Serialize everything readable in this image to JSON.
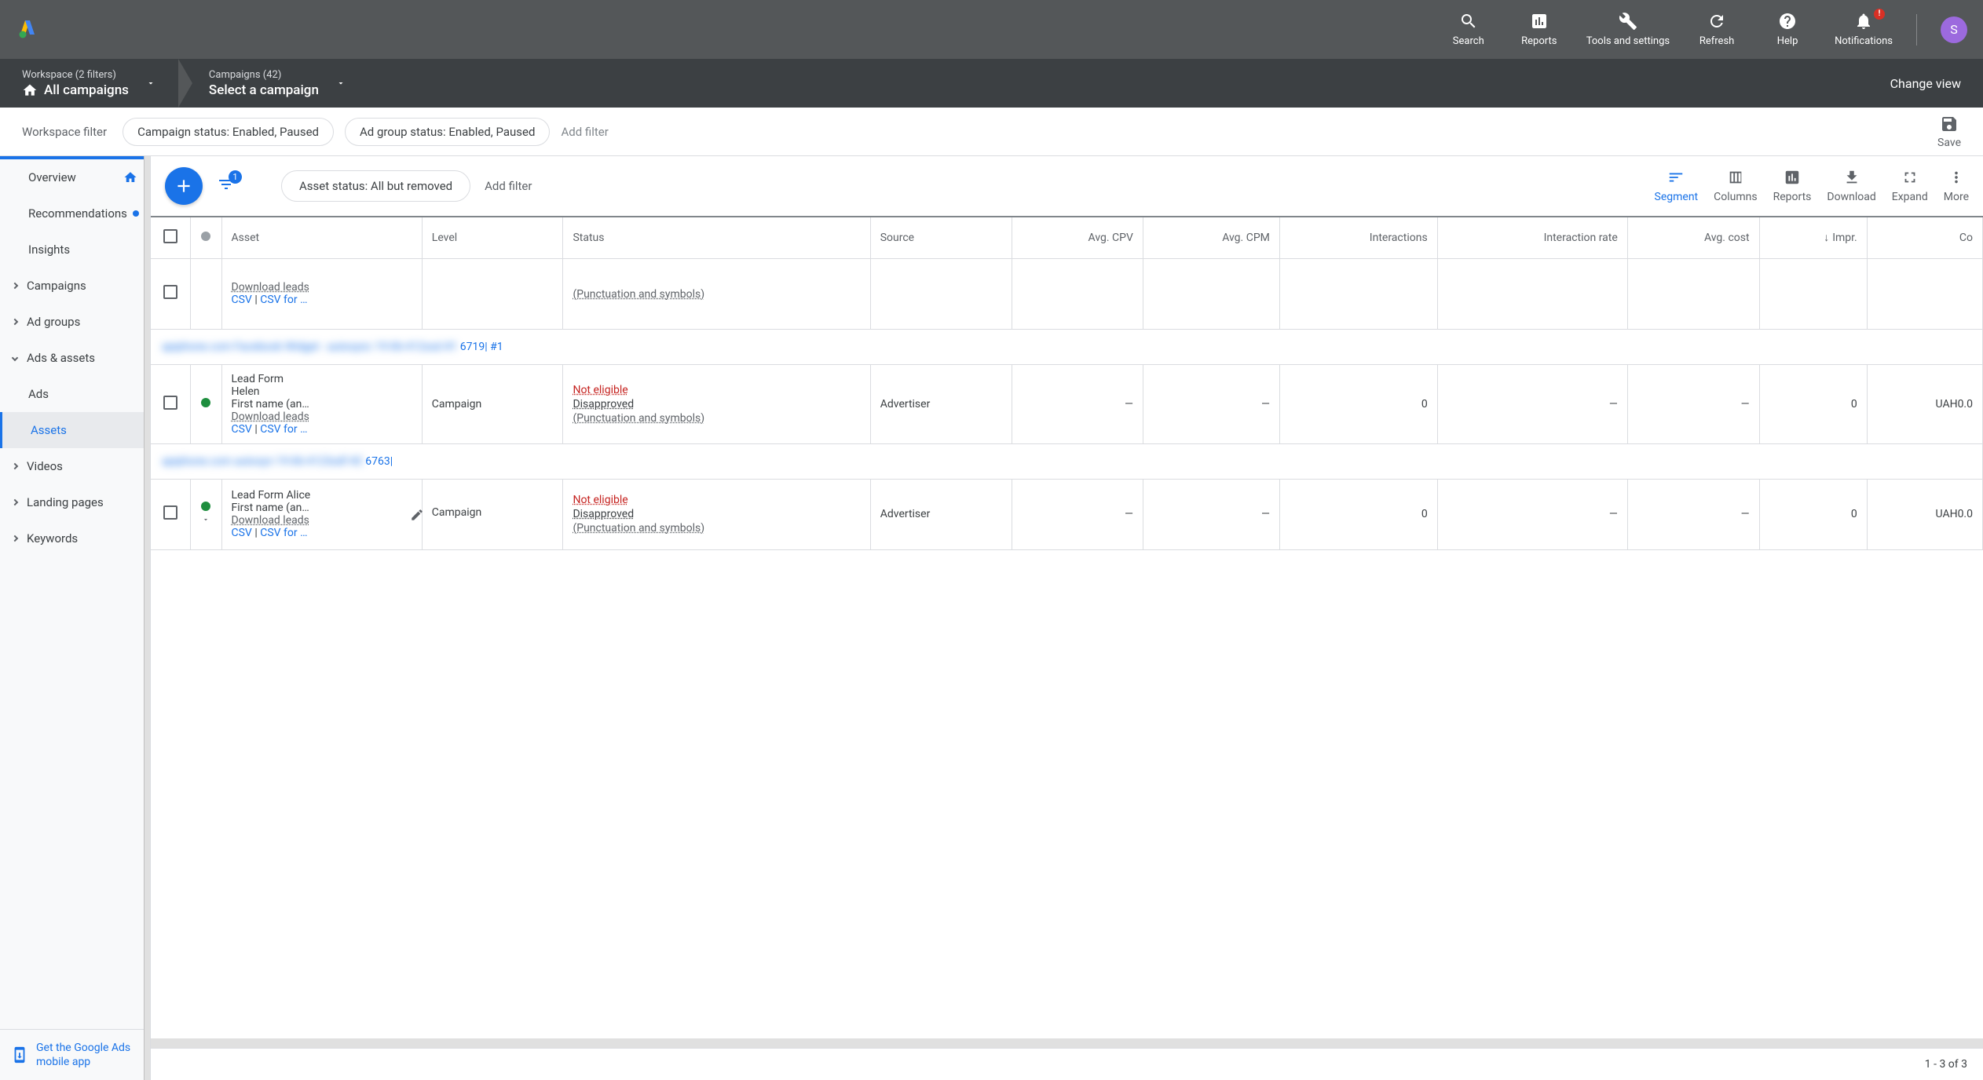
{
  "header": {
    "actions": [
      {
        "id": "search",
        "label": "Search"
      },
      {
        "id": "reports",
        "label": "Reports"
      },
      {
        "id": "tools",
        "label": "Tools and settings"
      },
      {
        "id": "refresh",
        "label": "Refresh"
      },
      {
        "id": "help",
        "label": "Help"
      },
      {
        "id": "notifications",
        "label": "Notifications",
        "badge": "!"
      }
    ],
    "avatar_letter": "S"
  },
  "breadcrumb": {
    "item1_sub": "Workspace (2 filters)",
    "item1_main": "All campaigns",
    "item2_sub": "Campaigns (42)",
    "item2_main": "Select a campaign",
    "change_view": "Change view"
  },
  "filter_bar": {
    "label": "Workspace filter",
    "chip1": "Campaign status: Enabled, Paused",
    "chip2": "Ad group status: Enabled, Paused",
    "add": "Add filter",
    "save": "Save"
  },
  "sidebar": {
    "overview": "Overview",
    "recommendations": "Recommendations",
    "insights": "Insights",
    "campaigns": "Campaigns",
    "ad_groups": "Ad groups",
    "ads_assets": "Ads & assets",
    "ads": "Ads",
    "assets": "Assets",
    "videos": "Videos",
    "landing_pages": "Landing pages",
    "keywords": "Keywords",
    "footer_link": "Get the Google Ads mobile app"
  },
  "toolbar": {
    "filter_badge": "1",
    "status_chip": "Asset status: All but removed",
    "add_filter": "Add filter",
    "actions": {
      "segment": "Segment",
      "columns": "Columns",
      "reports": "Reports",
      "download": "Download",
      "expand": "Expand",
      "more": "More"
    }
  },
  "table": {
    "headers": {
      "asset": "Asset",
      "level": "Level",
      "status": "Status",
      "source": "Source",
      "avg_cpv": "Avg. CPV",
      "avg_cpm": "Avg. CPM",
      "interactions": "Interactions",
      "interaction_rate": "Interaction rate",
      "avg_cost": "Avg. cost",
      "impr": "Impr.",
      "cost": "Co"
    },
    "partial_row": {
      "dl": "Download leads",
      "csv": "CSV",
      "csv_for": "CSV for …",
      "reason": "(Punctuation and symbols)"
    },
    "group1": {
      "obscured": "apiphone.com Facebook Widget - autosync 19-06-412ssd #1",
      "suffix": "6719| #1"
    },
    "row1": {
      "title": "Lead Form",
      "name": "Helen",
      "fields": "First name (an…",
      "dl": "Download leads",
      "csv": "CSV",
      "csv_for": "CSV for …",
      "level": "Campaign",
      "ne": "Not eligible",
      "dis": "Disapproved",
      "reason": "(Punctuation and symbols)",
      "source": "Advertiser",
      "cpv": "—",
      "cpm": "—",
      "inter": "0",
      "rate": "—",
      "cost": "—",
      "impr": "0",
      "cost2": "UAH0.0"
    },
    "group2": {
      "obscured": "apiphone.com autosyn 19-06-4123sdf #2",
      "suffix": "6763|"
    },
    "row2": {
      "title": "Lead Form Alice",
      "fields": "First name (an…",
      "dl": "Download leads",
      "csv": "CSV",
      "csv_for": "CSV for …",
      "level": "Campaign",
      "ne": "Not eligible",
      "dis": "Disapproved",
      "reason": "(Punctuation and symbols)",
      "source": "Advertiser",
      "cpv": "—",
      "cpm": "—",
      "inter": "0",
      "rate": "—",
      "cost": "—",
      "impr": "0",
      "cost2": "UAH0.0"
    },
    "pagination": "1 - 3 of 3"
  }
}
